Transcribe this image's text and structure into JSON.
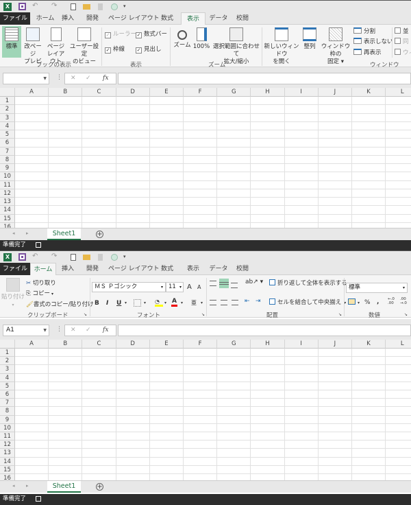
{
  "qat": {
    "dropdown_symbol": "▾"
  },
  "tabs": [
    "ファイル",
    "ホーム",
    "挿入",
    "開発",
    "ページ レイアウト",
    "数式",
    "表示",
    "データ",
    "校閲"
  ],
  "top_window": {
    "active_tab": "表示",
    "ribbon": {
      "workbook_views": {
        "label": "ブックの表示",
        "normal": "標準",
        "page_break": "改ページ\nプレビュー",
        "page_layout": "ページ\nレイアウト",
        "custom_views": "ユーザー設定\nのビュー"
      },
      "show": {
        "label": "表示",
        "ruler": "ルーラー",
        "formula_bar": "数式バー",
        "gridlines": "枠線",
        "headings": "見出し"
      },
      "zoom": {
        "label": "ズーム",
        "zoom": "ズーム",
        "zoom_100": "100%",
        "zoom_selection": "選択範囲に合わせて\n拡大/縮小"
      },
      "window": {
        "label": "ウィンドウ",
        "new_window": "新しいウィンドウ\nを開く",
        "arrange": "整列",
        "freeze": "ウィンドウ枠の\n固定 ▾",
        "split": "分割",
        "hide": "表示しない",
        "unhide": "再表示",
        "side_by_side": "並",
        "sync": "同",
        "reset": "ウィ"
      }
    },
    "name_box": "",
    "rows": [
      "1",
      "2",
      "3",
      "4",
      "5",
      "6",
      "7",
      "8",
      "9",
      "10",
      "11",
      "12",
      "13",
      "14",
      "15",
      "16"
    ]
  },
  "bottom_window": {
    "active_tab": "ホーム",
    "ribbon": {
      "clipboard": {
        "label": "クリップボード",
        "paste": "貼り付け",
        "cut": "切り取り",
        "copy": "コピー",
        "format_painter": "書式のコピー/貼り付け"
      },
      "font": {
        "label": "フォント",
        "font_name": "ＭＳ Ｐゴシック",
        "font_size": "11",
        "bold": "B",
        "italic": "I",
        "underline": "U",
        "grow": "A",
        "shrink": "A",
        "font_color": "A",
        "phonetic": "亜"
      },
      "alignment": {
        "label": "配置",
        "wrap_text": "折り返して全体を表示する",
        "merge_center": "セルを結合して中央揃え"
      },
      "number": {
        "label": "数値",
        "format": "標準",
        "percent": "%",
        "comma": ",",
        "inc_decimal": "←.0\n.00",
        "dec_decimal": ".00\n→.0"
      }
    },
    "name_box": "A1",
    "rows": [
      "1",
      "2",
      "3",
      "4",
      "5",
      "6",
      "7",
      "8",
      "9",
      "10",
      "11",
      "12",
      "13",
      "14",
      "15",
      "16"
    ]
  },
  "columns": [
    "A",
    "B",
    "C",
    "D",
    "E",
    "F",
    "G",
    "H",
    "I",
    "J",
    "K",
    "L"
  ],
  "formula_bar": {
    "cancel": "✕",
    "enter": "✓",
    "fx": "fx"
  },
  "sheet_tab": "Sheet1",
  "status_text": "準備完了",
  "colors": {
    "accent": "#217346",
    "selected": "#9fd5b7",
    "status_bar": "#2d2d2d"
  }
}
